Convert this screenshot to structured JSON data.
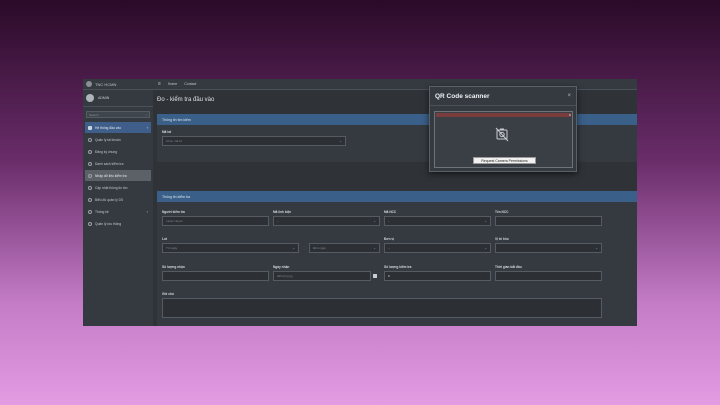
{
  "sidebar": {
    "brand": "TNC HCMN",
    "user": "ADMIN",
    "search_placeholder": "Search",
    "items": [
      {
        "label": "Hệ thống đầu vào",
        "arrow": "‹"
      },
      {
        "label": "Quản lý tài khoản"
      },
      {
        "label": "Đăng ký chung"
      },
      {
        "label": "Danh sách kiểm tra"
      },
      {
        "label": "Nhập dữ liệu kiểm tra"
      },
      {
        "label": "Cập nhật thông tin tồn"
      },
      {
        "label": "Biểu đồ quản lý DS"
      },
      {
        "label": "Thống kê",
        "arrow": "‹"
      },
      {
        "label": "Quản lý lưu thông"
      }
    ]
  },
  "topbar": {
    "links": [
      "Home",
      "Contact"
    ]
  },
  "page": {
    "title": "Đo - kiểm tra đầu vào"
  },
  "card1": {
    "header": "Thông tin tìm kiếm",
    "field_label": "Mã lot",
    "select_value": "Chọn mã lot"
  },
  "card2": {
    "header": "Thông tin kiểm tra",
    "labels": {
      "inspector": "Người kiểm tra",
      "component_code": "Mã linh kiện",
      "ncc_code": "Mã NCC",
      "ncc_name": "Tên NCC",
      "lot": "Lot",
      "unit": "Đơn vị",
      "warehouse": "Vị trí kho",
      "received_qty": "Số lượng nhận",
      "received_date": "Ngày nhận",
      "inspect_qty": "Số lượng kiểm tra",
      "start_time": "Thời gian bắt đầu",
      "note": "Ghi chú"
    },
    "values": {
      "inspector": "Laser Huyen",
      "select_default": "--",
      "from_placeholder": "Từ ngày",
      "to_placeholder": "Đến ngày",
      "date_placeholder": "dd/mm/yyyy",
      "inspect_qty": "0"
    }
  },
  "modal": {
    "title": "QR Code scanner",
    "close": "×",
    "button": "Request Camera Permissions",
    "scan_close": "x"
  }
}
